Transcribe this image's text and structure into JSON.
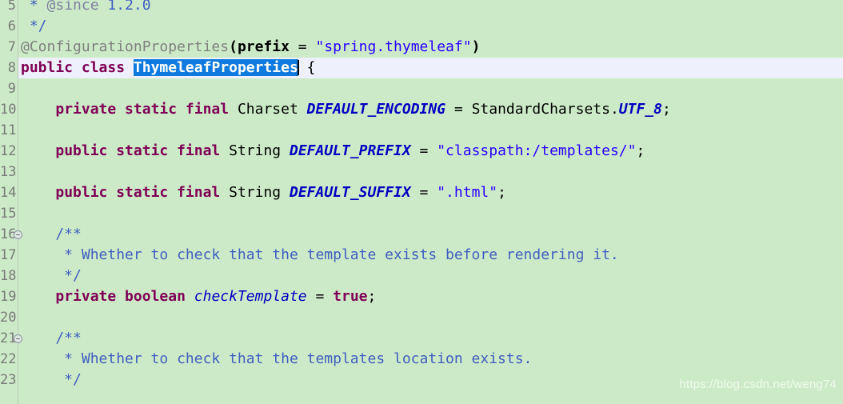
{
  "editor": {
    "background_color": "#cdeac8",
    "current_line_color": "#eef1fb",
    "selection_color": "#0e7ae0",
    "gutter_separator_color": "#bfc7bd",
    "line_height_px": 26,
    "first_visible_line": 5,
    "last_visible_line": 23
  },
  "watermark": {
    "text": "https://blog.csdn.net/weng74"
  },
  "gutter": {
    "numbers": [
      "5",
      "6",
      "7",
      "8",
      "9",
      "10",
      "11",
      "12",
      "13",
      "14",
      "15",
      "16",
      "17",
      "18",
      "19",
      "20",
      "21",
      "22",
      "23"
    ],
    "fold_markers_on_lines": [
      "16",
      "21"
    ],
    "fold_marker_icon": "collapse-minus-circle-icon"
  },
  "code": {
    "language": "Java",
    "class_name": "ThymeleafProperties",
    "selected_text": "ThymeleafProperties",
    "current_line_number": 8,
    "lines": [
      {
        "number": "5",
        "text": " * @since 1.2.0",
        "tokens": [
          {
            "t": " * ",
            "c": "cmt"
          },
          {
            "t": "@since",
            "c": "cmttag"
          },
          {
            "t": " ",
            "c": "cmt"
          },
          {
            "t": "1.2.0",
            "c": "cmt"
          }
        ]
      },
      {
        "number": "6",
        "text": " */",
        "tokens": [
          {
            "t": " */",
            "c": "cmt"
          }
        ]
      },
      {
        "number": "7",
        "text": "@ConfigurationProperties(prefix = \"spring.thymeleaf\")",
        "tokens": [
          {
            "t": "@ConfigurationProperties",
            "c": "anno"
          },
          {
            "t": "(",
            "c": "annoarg"
          },
          {
            "t": "prefix",
            "c": "annoarg"
          },
          {
            "t": " = ",
            "c": "op"
          },
          {
            "t": "\"spring.thymeleaf\"",
            "c": "str"
          },
          {
            "t": ")",
            "c": "annoarg"
          }
        ]
      },
      {
        "number": "8",
        "text": "public class ThymeleafProperties {",
        "current": true,
        "tokens": [
          {
            "t": "public",
            "c": "kw"
          },
          {
            "t": " ",
            "c": "punct"
          },
          {
            "t": "class",
            "c": "kw"
          },
          {
            "t": " ",
            "c": "punct"
          },
          {
            "t": "ThymeleafProperties",
            "c": "sel"
          },
          {
            "t": "CARET",
            "c": "caret"
          },
          {
            "t": " {",
            "c": "punct"
          }
        ]
      },
      {
        "number": "9",
        "text": "",
        "tokens": []
      },
      {
        "number": "10",
        "text": "    private static final Charset DEFAULT_ENCODING = StandardCharsets.UTF_8;",
        "tokens": [
          {
            "t": "    ",
            "c": "punct"
          },
          {
            "t": "private static final",
            "c": "kw"
          },
          {
            "t": " ",
            "c": "punct"
          },
          {
            "t": "Charset",
            "c": "type"
          },
          {
            "t": " ",
            "c": "punct"
          },
          {
            "t": "DEFAULT_ENCODING",
            "c": "field"
          },
          {
            "t": " = ",
            "c": "op"
          },
          {
            "t": "StandardCharsets",
            "c": "type"
          },
          {
            "t": ".",
            "c": "punct"
          },
          {
            "t": "UTF_8",
            "c": "field"
          },
          {
            "t": ";",
            "c": "punct"
          }
        ]
      },
      {
        "number": "11",
        "text": "",
        "tokens": []
      },
      {
        "number": "12",
        "text": "    public static final String DEFAULT_PREFIX = \"classpath:/templates/\";",
        "tokens": [
          {
            "t": "    ",
            "c": "punct"
          },
          {
            "t": "public static final",
            "c": "kw"
          },
          {
            "t": " ",
            "c": "punct"
          },
          {
            "t": "String",
            "c": "type"
          },
          {
            "t": " ",
            "c": "punct"
          },
          {
            "t": "DEFAULT_PREFIX",
            "c": "field"
          },
          {
            "t": " = ",
            "c": "op"
          },
          {
            "t": "\"classpath:/templates/\"",
            "c": "str"
          },
          {
            "t": ";",
            "c": "punct"
          }
        ]
      },
      {
        "number": "13",
        "text": "",
        "tokens": []
      },
      {
        "number": "14",
        "text": "    public static final String DEFAULT_SUFFIX = \".html\";",
        "tokens": [
          {
            "t": "    ",
            "c": "punct"
          },
          {
            "t": "public static final",
            "c": "kw"
          },
          {
            "t": " ",
            "c": "punct"
          },
          {
            "t": "String",
            "c": "type"
          },
          {
            "t": " ",
            "c": "punct"
          },
          {
            "t": "DEFAULT_SUFFIX",
            "c": "field"
          },
          {
            "t": " = ",
            "c": "op"
          },
          {
            "t": "\".html\"",
            "c": "str"
          },
          {
            "t": ";",
            "c": "punct"
          }
        ]
      },
      {
        "number": "15",
        "text": "",
        "tokens": []
      },
      {
        "number": "16",
        "text": "    /**",
        "fold": true,
        "tokens": [
          {
            "t": "    /**",
            "c": "cmt"
          }
        ]
      },
      {
        "number": "17",
        "text": "     * Whether to check that the template exists before rendering it.",
        "tokens": [
          {
            "t": "     * Whether to check that the template exists before rendering it.",
            "c": "cmt"
          }
        ]
      },
      {
        "number": "18",
        "text": "     */",
        "tokens": [
          {
            "t": "     */",
            "c": "cmt"
          }
        ]
      },
      {
        "number": "19",
        "text": "    private boolean checkTemplate = true;",
        "tokens": [
          {
            "t": "    ",
            "c": "punct"
          },
          {
            "t": "private boolean",
            "c": "kw"
          },
          {
            "t": " ",
            "c": "punct"
          },
          {
            "t": "checkTemplate",
            "c": "fieldn"
          },
          {
            "t": " = ",
            "c": "op"
          },
          {
            "t": "true",
            "c": "kw"
          },
          {
            "t": ";",
            "c": "punct"
          }
        ]
      },
      {
        "number": "20",
        "text": "",
        "tokens": []
      },
      {
        "number": "21",
        "text": "    /**",
        "fold": true,
        "tokens": [
          {
            "t": "    /**",
            "c": "cmt"
          }
        ]
      },
      {
        "number": "22",
        "text": "     * Whether to check that the templates location exists.",
        "tokens": [
          {
            "t": "     * Whether to check that the templates location exists.",
            "c": "cmt"
          }
        ]
      },
      {
        "number": "23",
        "text": "     */",
        "tokens": [
          {
            "t": "     */",
            "c": "cmt"
          }
        ]
      }
    ]
  }
}
